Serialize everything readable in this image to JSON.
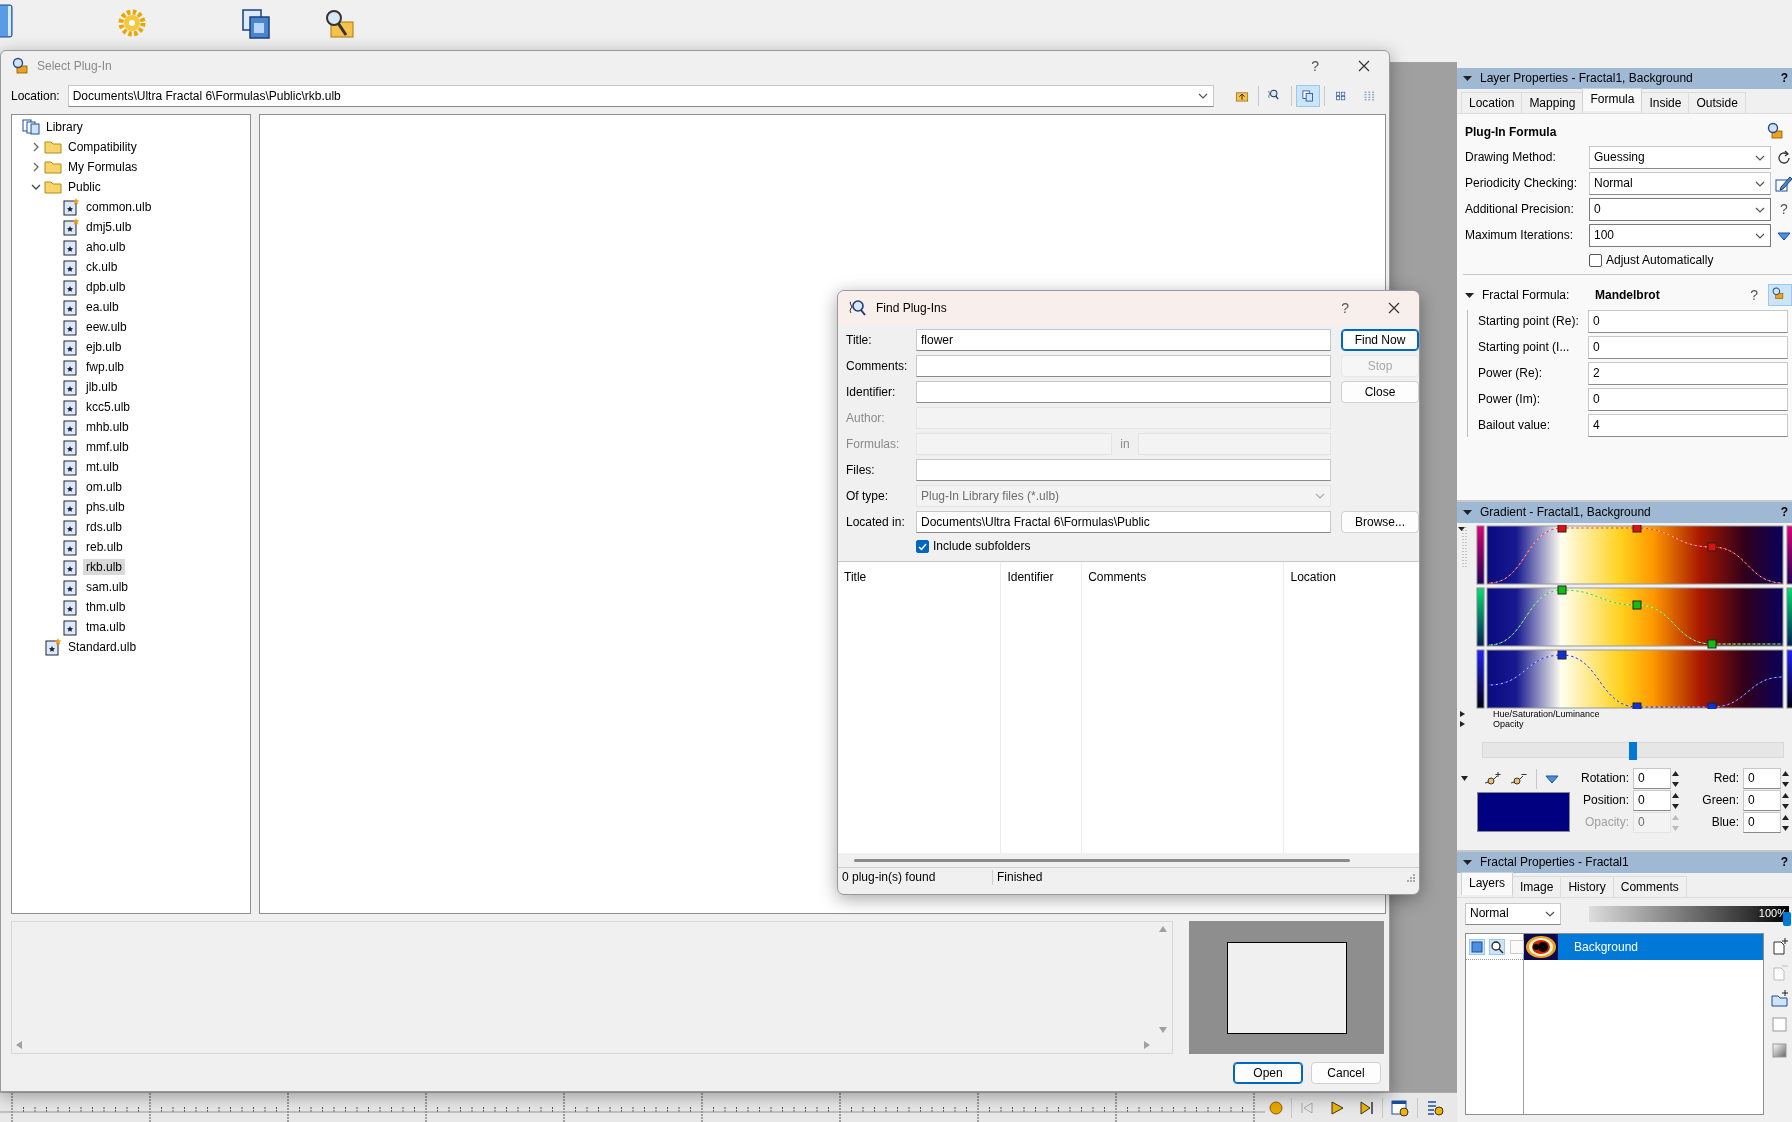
{
  "select_dialog": {
    "title": "Select Plug-In",
    "help": "?",
    "location": {
      "label": "Location:",
      "value": "Documents\\Ultra Fractal 6\\Formulas\\Public\\rkb.ulb"
    },
    "tree": [
      {
        "label": "Library",
        "kind": "library",
        "selected": false,
        "children": [
          {
            "label": "Compatibility",
            "kind": "folder",
            "expanded": false,
            "selected": false
          },
          {
            "label": "My Formulas",
            "kind": "folder",
            "expanded": false,
            "selected": false
          },
          {
            "label": "Public",
            "kind": "folder",
            "expanded": true,
            "selected": false,
            "children": [
              {
                "label": "common.ulb",
                "kind": "file",
                "starred": true,
                "selected": false
              },
              {
                "label": "dmj5.ulb",
                "kind": "file",
                "starred": true,
                "selected": false
              },
              {
                "label": "aho.ulb",
                "kind": "file",
                "starred": false,
                "selected": false
              },
              {
                "label": "ck.ulb",
                "kind": "file",
                "starred": false,
                "selected": false
              },
              {
                "label": "dpb.ulb",
                "kind": "file",
                "starred": false,
                "selected": false
              },
              {
                "label": "ea.ulb",
                "kind": "file",
                "starred": false,
                "selected": false
              },
              {
                "label": "eew.ulb",
                "kind": "file",
                "starred": false,
                "selected": false
              },
              {
                "label": "ejb.ulb",
                "kind": "file",
                "starred": false,
                "selected": false
              },
              {
                "label": "fwp.ulb",
                "kind": "file",
                "starred": false,
                "selected": false
              },
              {
                "label": "jlb.ulb",
                "kind": "file",
                "starred": false,
                "selected": false
              },
              {
                "label": "kcc5.ulb",
                "kind": "file",
                "starred": false,
                "selected": false
              },
              {
                "label": "mhb.ulb",
                "kind": "file",
                "starred": false,
                "selected": false
              },
              {
                "label": "mmf.ulb",
                "kind": "file",
                "starred": false,
                "selected": false
              },
              {
                "label": "mt.ulb",
                "kind": "file",
                "starred": false,
                "selected": false
              },
              {
                "label": "om.ulb",
                "kind": "file",
                "starred": false,
                "selected": false
              },
              {
                "label": "phs.ulb",
                "kind": "file",
                "starred": false,
                "selected": false
              },
              {
                "label": "rds.ulb",
                "kind": "file",
                "starred": false,
                "selected": false
              },
              {
                "label": "reb.ulb",
                "kind": "file",
                "starred": false,
                "selected": false
              },
              {
                "label": "rkb.ulb",
                "kind": "file",
                "starred": false,
                "selected": true
              },
              {
                "label": "sam.ulb",
                "kind": "file",
                "starred": false,
                "selected": false
              },
              {
                "label": "thm.ulb",
                "kind": "file",
                "starred": false,
                "selected": false
              },
              {
                "label": "tma.ulb",
                "kind": "file",
                "starred": false,
                "selected": false
              }
            ]
          },
          {
            "label": "Standard.ulb",
            "kind": "file",
            "starred": true,
            "selected": false
          }
        ]
      }
    ],
    "buttons": [
      {
        "label": "Open",
        "default": true
      },
      {
        "label": "Cancel",
        "default": false
      }
    ]
  },
  "find_dialog": {
    "title": "Find Plug-Ins",
    "help": "?",
    "fields": [
      {
        "label": "Title:",
        "kind": "text",
        "value": "flower",
        "disabled": false
      },
      {
        "label": "Comments:",
        "kind": "text",
        "disabled": false
      },
      {
        "label": "Identifier:",
        "kind": "text",
        "disabled": false
      },
      {
        "label": "Author:",
        "kind": "text",
        "disabled": true
      },
      {
        "label": "Formulas:",
        "kind": "formulas",
        "joiner": "in",
        "disabled": true
      },
      {
        "label": "Files:",
        "kind": "text",
        "disabled": false
      },
      {
        "label": "Of type:",
        "kind": "select",
        "value": "Plug-In Library files (*.ulb)",
        "disabled": true
      },
      {
        "label": "Located in:",
        "kind": "text",
        "value": "Documents\\Ultra Fractal 6\\Formulas\\Public",
        "disabled": false,
        "button": "Browse..."
      }
    ],
    "buttons": [
      {
        "label": "Find Now",
        "disabled": false,
        "default": true
      },
      {
        "label": "Stop",
        "disabled": true,
        "default": false
      },
      {
        "label": "Close",
        "disabled": false,
        "default": false
      }
    ],
    "include_subfolders": {
      "label": "Include subfolders",
      "checked": true
    },
    "columns": [
      "Title",
      "Identifier",
      "Comments",
      "Location"
    ],
    "status": [
      "0 plug-in(s) found",
      "Finished"
    ]
  },
  "layer_properties": {
    "title": "Layer Properties - Fractal1, Background",
    "help": "?",
    "tabs": [
      {
        "label": "Location",
        "selected": false
      },
      {
        "label": "Mapping",
        "selected": false
      },
      {
        "label": "Formula",
        "selected": true
      },
      {
        "label": "Inside",
        "selected": false
      },
      {
        "label": "Outside",
        "selected": false
      }
    ],
    "heading": "Plug-In Formula",
    "settings": [
      {
        "label": "Drawing Method:",
        "value": "Guessing",
        "kind": "dropdown"
      },
      {
        "label": "Periodicity Checking:",
        "value": "Normal",
        "kind": "dropdown"
      },
      {
        "label": "Additional Precision:",
        "value": "0",
        "kind": "combo",
        "help": "?"
      },
      {
        "label": "Maximum Iterations:",
        "value": "100",
        "kind": "combo"
      }
    ],
    "adjust_automatically": {
      "label": "Adjust Automatically",
      "checked": false
    },
    "fractal_formula": {
      "label": "Fractal Formula:",
      "value": "Mandelbrot",
      "help": "?",
      "expanded": true,
      "params": [
        {
          "label": "Starting point (Re):",
          "value": "0"
        },
        {
          "label": "Starting point (I...",
          "value": "0"
        },
        {
          "label": "Power (Re):",
          "value": "2"
        },
        {
          "label": "Power (Im):",
          "value": "0"
        },
        {
          "label": "Bailout value:",
          "value": "4"
        }
      ]
    }
  },
  "gradient": {
    "title": "Gradient - Fractal1, Background",
    "help": "?",
    "sections": [
      {
        "label": "Hue/Saturation/Luminance",
        "expanded": false
      },
      {
        "label": "Opacity",
        "expanded": false
      }
    ],
    "position_slider": {
      "level": 0.5
    },
    "fields": [
      {
        "label": "Rotation:",
        "value": "0",
        "disabled": false
      },
      {
        "label": "Position:",
        "value": "0",
        "disabled": false
      },
      {
        "label": "Opacity:",
        "value": "0",
        "disabled": true
      }
    ],
    "channels": [
      {
        "label": "Red:",
        "value": "0"
      },
      {
        "label": "Green:",
        "value": "0"
      },
      {
        "label": "Blue:",
        "value": "0"
      }
    ]
  },
  "fractal_properties": {
    "title": "Fractal Properties - Fractal1",
    "help": "?",
    "tabs": [
      {
        "label": "Layers",
        "selected": true
      },
      {
        "label": "Image",
        "selected": false
      },
      {
        "label": "History",
        "selected": false
      },
      {
        "label": "Comments",
        "selected": false
      }
    ],
    "blend_mode": "Normal",
    "opacity": {
      "reading": "100%",
      "level": 1
    },
    "layers": [
      {
        "name": "Background",
        "selected": true
      }
    ]
  }
}
